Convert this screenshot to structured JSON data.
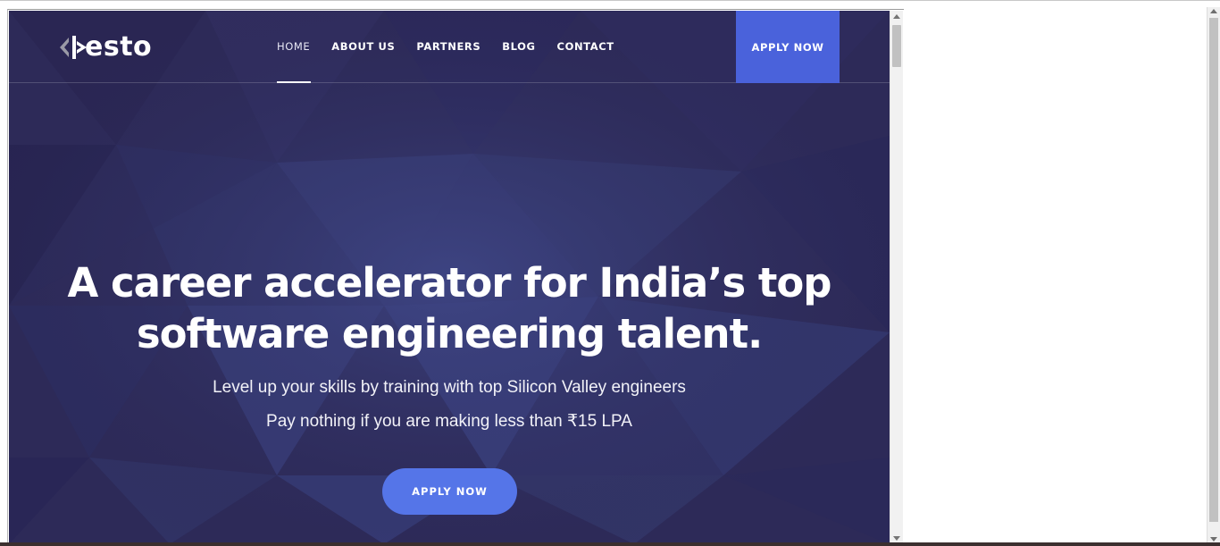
{
  "brand": {
    "logo_text": "esto",
    "logo_mark": "pesto-logo-icon"
  },
  "nav": {
    "items": [
      {
        "label": "HOME",
        "active": true
      },
      {
        "label": "ABOUT US",
        "active": false
      },
      {
        "label": "PARTNERS",
        "active": false
      },
      {
        "label": "BLOG",
        "active": false
      },
      {
        "label": "CONTACT",
        "active": false
      }
    ],
    "cta_label": "APPLY NOW"
  },
  "hero": {
    "title_line1": "A career accelerator for India’s top",
    "title_line2": "software engineering talent.",
    "subtitle1": "Level up your skills by training with top Silicon Valley engineers",
    "subtitle2": "Pay nothing if you are making less than ₹15 LPA",
    "cta_label": "APPLY NOW"
  },
  "colors": {
    "background": "#2e2c5a",
    "accent": "#4a62db",
    "hero_button": "#5575e8",
    "text": "#ffffff"
  }
}
